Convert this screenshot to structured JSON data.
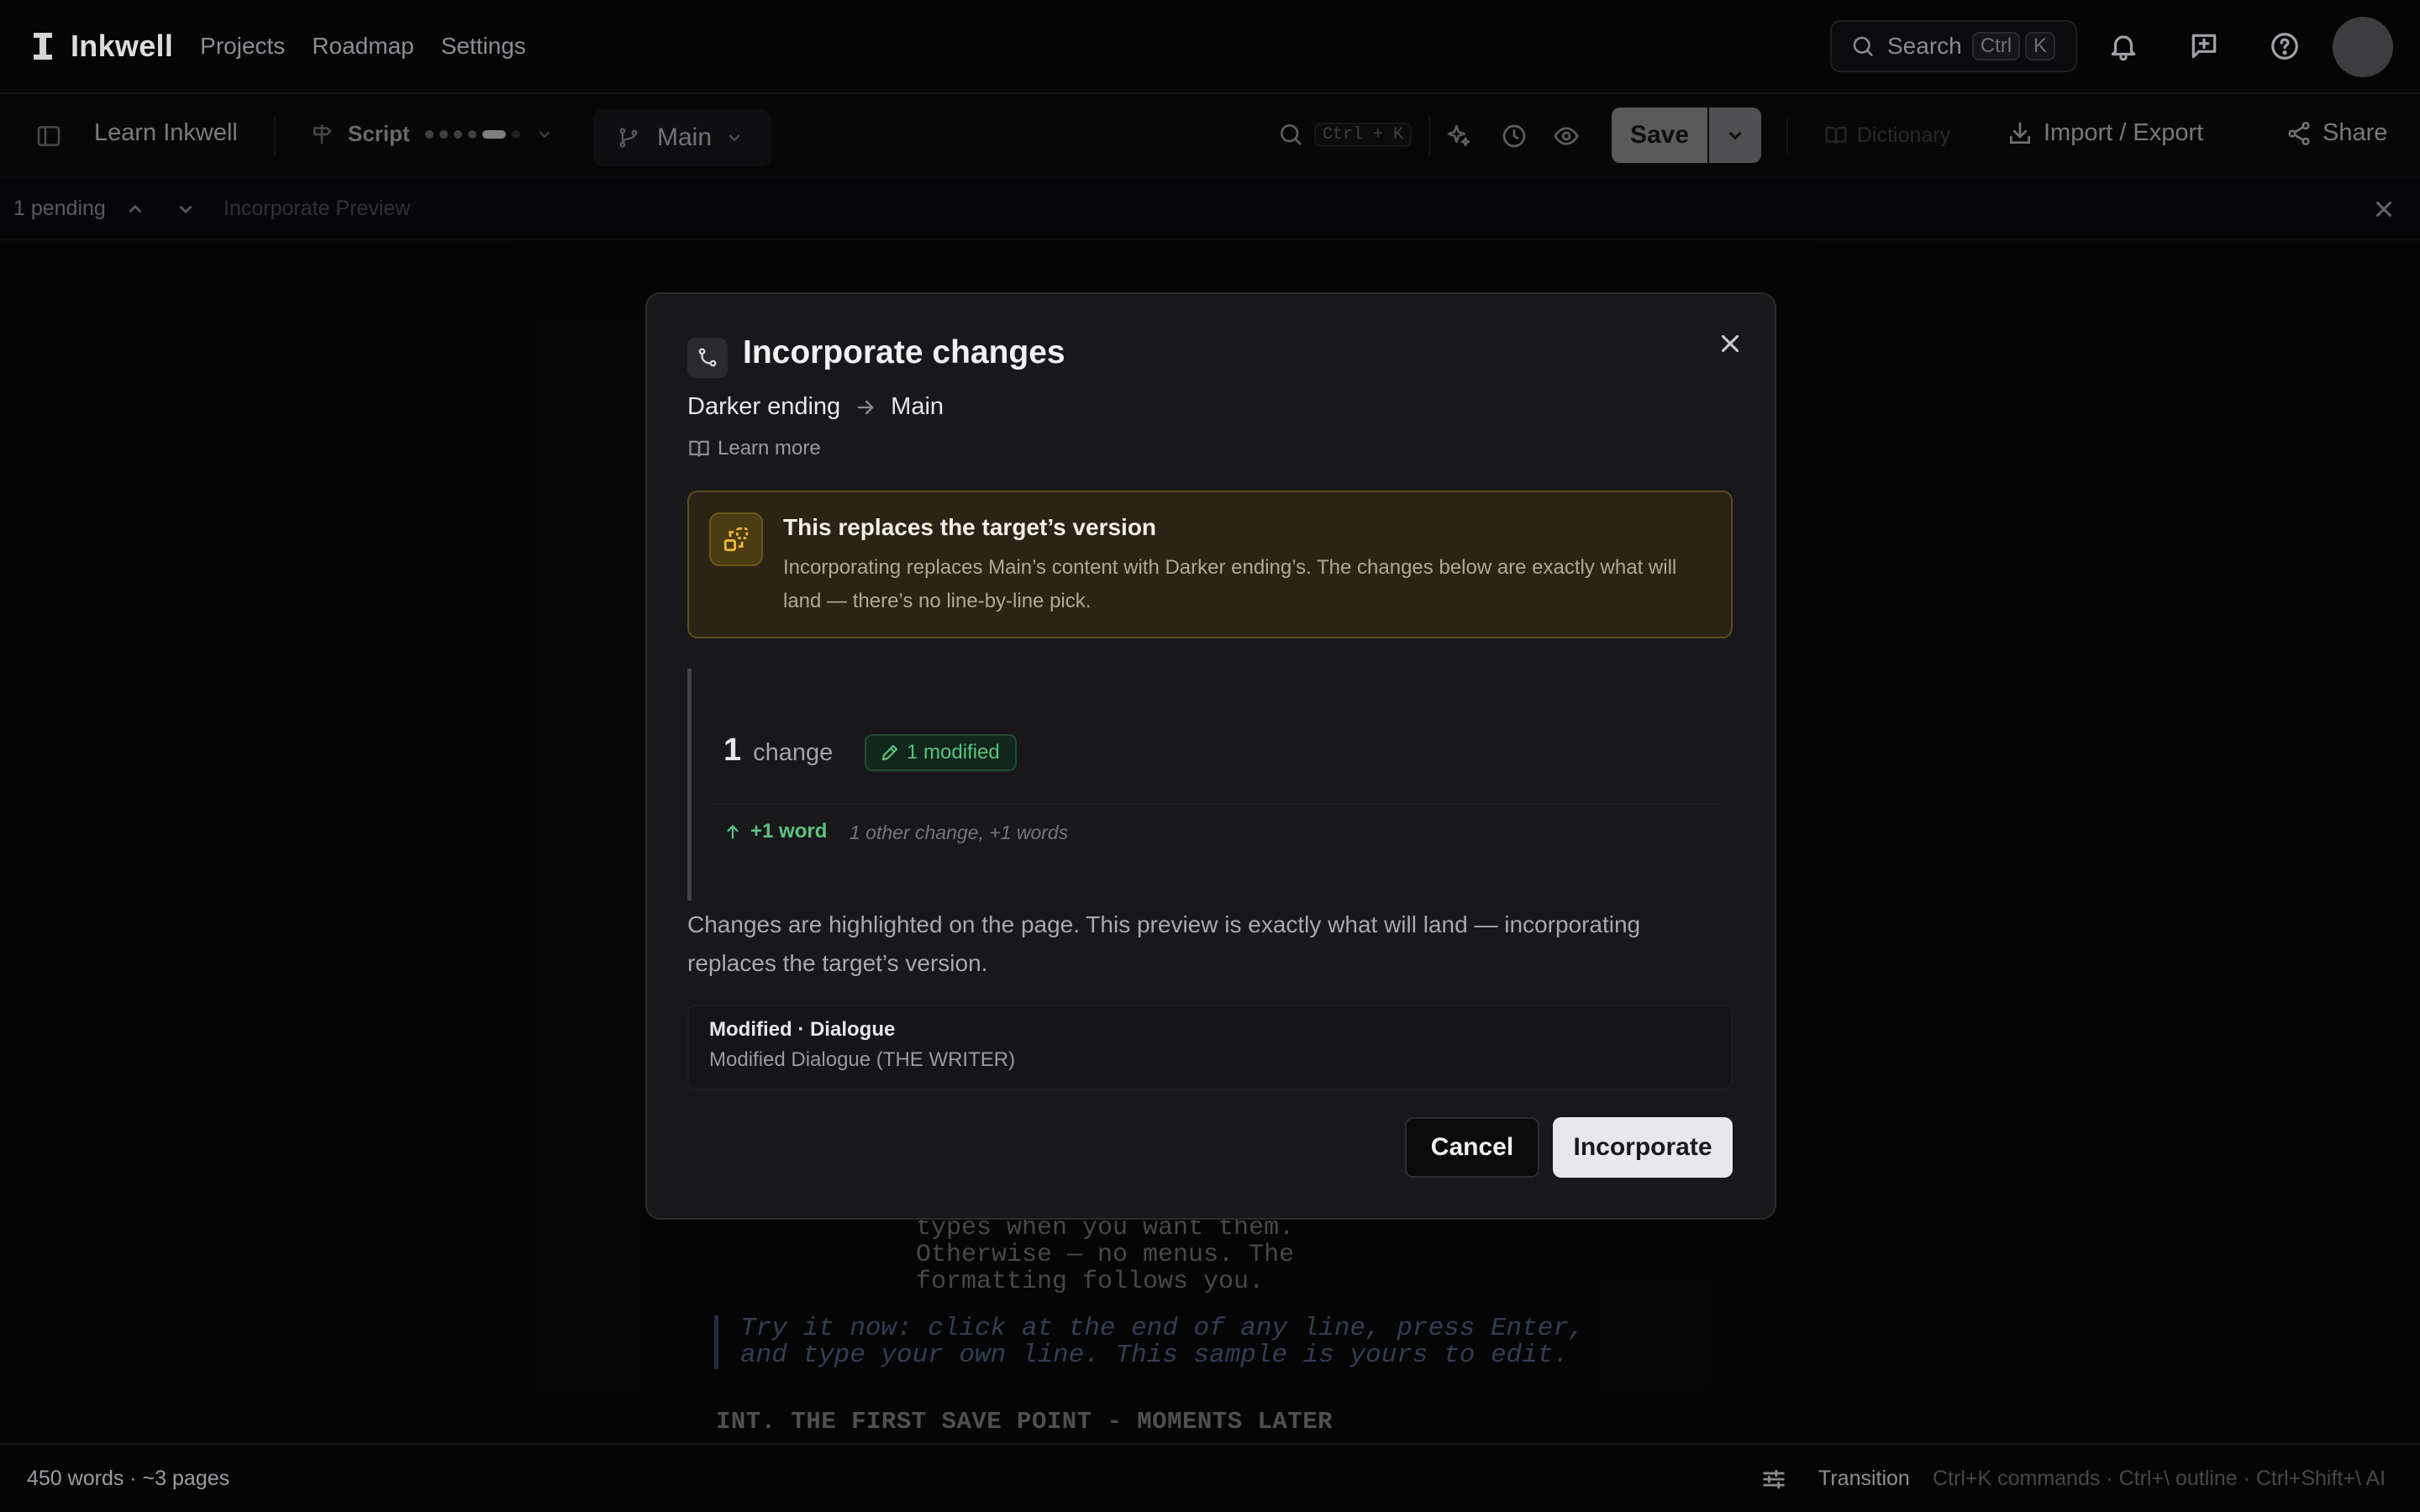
{
  "app": {
    "name": "Inkwell",
    "nav": [
      "Projects",
      "Roadmap",
      "Settings"
    ],
    "search_label": "Search",
    "search_kbd": [
      "Ctrl",
      "K"
    ]
  },
  "toolbar": {
    "doc_title": "Learn Inkwell",
    "script_label": "Script",
    "branch_label": "Main",
    "find_kbd": "Ctrl + K",
    "save_label": "Save",
    "dictionary_label": "Dictionary",
    "import_export_label": "Import / Export",
    "share_label": "Share"
  },
  "pending": {
    "count_label": "1 pending",
    "title": "Incorporate Preview"
  },
  "page": {
    "dialogue_lines": [
      "types when you want them.",
      "Otherwise — no menus. The",
      "formatting follows you."
    ],
    "hint_lines": [
      "Try it now: click at the end of any line, press Enter,",
      "and type your own line. This sample is yours to edit."
    ],
    "scene_heading": "INT. THE FIRST SAVE POINT - MOMENTS LATER"
  },
  "modal": {
    "title": "Incorporate changes",
    "source": "Darker ending",
    "target": "Main",
    "learn_more": "Learn more",
    "warning": {
      "title": "This replaces the target’s version",
      "body": "Incorporating replaces Main’s content with Darker ending’s. The changes below are exactly what will land — there’s no line-by-line pick."
    },
    "changes": {
      "count": "1",
      "count_label": "change",
      "badge": "1 modified",
      "words_delta": "+1 word",
      "other": "1 other change, +1 words"
    },
    "note": "Changes are highlighted on the page. This preview is exactly what will land — incorporating replaces the target’s version.",
    "modified_card": {
      "title": "Modified · Dialogue",
      "subtitle": "Modified Dialogue (THE WRITER)"
    },
    "cancel_label": "Cancel",
    "incorporate_label": "Incorporate"
  },
  "status": {
    "words": "450 words · ~3 pages",
    "element_type": "Transition",
    "shortcuts_hint": "Ctrl+K commands · Ctrl+\\ outline · Ctrl+Shift+\\ AI"
  },
  "colors": {
    "accent_warning": "#f0b63a",
    "accent_positive": "#5bc37d",
    "primary_button": "#e8e8ea"
  }
}
